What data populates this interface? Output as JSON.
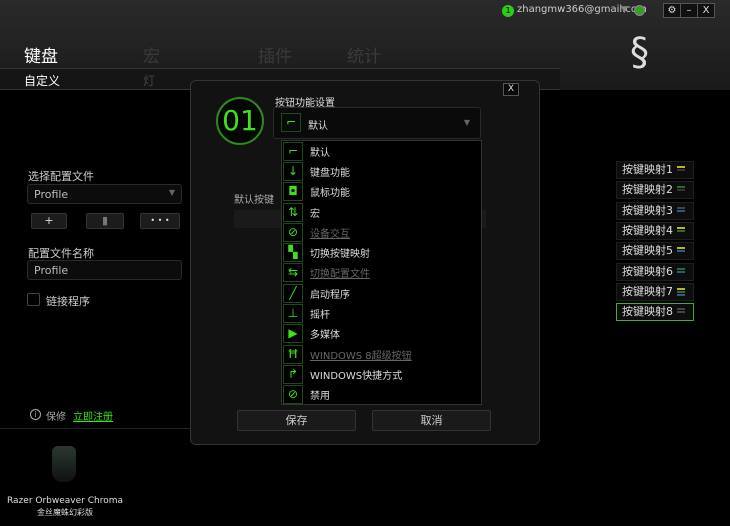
{
  "header": {
    "badge": "1",
    "account": "zhangmw366@gmail.com",
    "settings": "⚙",
    "minimize": "–",
    "close": "X"
  },
  "tabs": [
    {
      "label": "键盘",
      "active": true
    },
    {
      "label": "宏"
    },
    {
      "label": "插件"
    },
    {
      "label": "统计"
    }
  ],
  "subtabs": [
    {
      "label": "自定义"
    },
    {
      "label": "灯"
    }
  ],
  "left": {
    "select_profile_label": "选择配置文件",
    "profile_value": "Profile",
    "add": "+",
    "delete": "▮",
    "more": "• • •",
    "profile_name_label": "配置文件名称",
    "profile_name_value": "Profile",
    "link_program": "链接程序",
    "warranty": "保修",
    "register": "立即注册",
    "device_name": "Razer Orbweaver Chroma",
    "device_cn": "金丝魔蛛幻彩版"
  },
  "keymaps": [
    {
      "label": "按键映射1",
      "colors": [
        "#b5b52a",
        "#333"
      ]
    },
    {
      "label": "按键映射2",
      "colors": [
        "#2a6a2a",
        "#333"
      ]
    },
    {
      "label": "按键映射3",
      "colors": [
        "#444",
        "#2a5a8a"
      ]
    },
    {
      "label": "按键映射4",
      "colors": [
        "#b5b52a",
        "#2a6a2a"
      ]
    },
    {
      "label": "按键映射5",
      "colors": [
        "#b5b52a",
        "#2a5a8a"
      ]
    },
    {
      "label": "按键映射6",
      "colors": [
        "#2a6a2a",
        "#2a5a8a"
      ]
    },
    {
      "label": "按键映射7",
      "colors": [
        "#b5b52a",
        "#2a6a2a",
        "#2a5a8a"
      ]
    },
    {
      "label": "按键映射8",
      "colors": [
        "#444",
        "#444"
      ],
      "selected": true
    }
  ],
  "dialog": {
    "close": "X",
    "key_number": "01",
    "title": "按钮功能设置",
    "selected": "默认",
    "default_key_label": "默认按键",
    "save": "保存",
    "cancel": "取消",
    "options": [
      {
        "label": "默认",
        "icon": "default-icon",
        "glyph": "⌐"
      },
      {
        "label": "键盘功能",
        "icon": "keyboard-icon",
        "glyph": "↓"
      },
      {
        "label": "鼠标功能",
        "icon": "mouse-icon",
        "glyph": "◘"
      },
      {
        "label": "宏",
        "icon": "macro-icon",
        "glyph": "⇅"
      },
      {
        "label": "设备交互",
        "icon": "device-icon",
        "glyph": "⊘",
        "disabled": true
      },
      {
        "label": "切换按键映射",
        "icon": "keymap-switch-icon",
        "glyph": "▚"
      },
      {
        "label": "切换配置文件",
        "icon": "profile-switch-icon",
        "glyph": "⇆",
        "disabled": true
      },
      {
        "label": "启动程序",
        "icon": "launch-icon",
        "glyph": "╱"
      },
      {
        "label": "摇杆",
        "icon": "joystick-icon",
        "glyph": "⊥"
      },
      {
        "label": "多媒体",
        "icon": "media-icon",
        "glyph": "▶"
      },
      {
        "label": "WINDOWS 8超级按钮",
        "icon": "charms-icon",
        "glyph": "Ħ",
        "disabled": true
      },
      {
        "label": "WINDOWS快捷方式",
        "icon": "shortcut-icon",
        "glyph": "↱"
      },
      {
        "label": "禁用",
        "icon": "disable-icon",
        "glyph": "⊘"
      }
    ]
  },
  "colors": {
    "accent": "#3fe01c"
  }
}
